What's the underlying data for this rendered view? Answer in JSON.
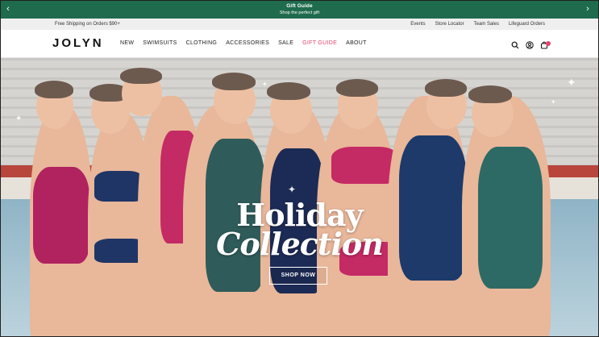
{
  "announcement": {
    "title": "Gift Guide",
    "subtitle": "Shop the perfect gift",
    "prev_icon": "chevron-left-icon",
    "next_icon": "chevron-right-icon"
  },
  "utility": {
    "shipping": "Free Shipping on Orders $90+",
    "links": [
      "Events",
      "Store Locator",
      "Team Sales",
      "Lifeguard Orders"
    ]
  },
  "nav": {
    "logo": "JOLYN",
    "items": [
      "NEW",
      "SWIMSUITS",
      "CLOTHING",
      "ACCESSORIES",
      "SALE",
      "GIFT GUIDE",
      "ABOUT"
    ],
    "highlight_color": "#e2456b",
    "icons": [
      "search-icon",
      "account-icon",
      "cart-icon"
    ]
  },
  "hero": {
    "headline_1": "Holiday",
    "headline_2": "Collection",
    "cta": "SHOP NOW"
  },
  "colors": {
    "announcement_bg": "#1f6b4d",
    "accent": "#e2456b"
  }
}
